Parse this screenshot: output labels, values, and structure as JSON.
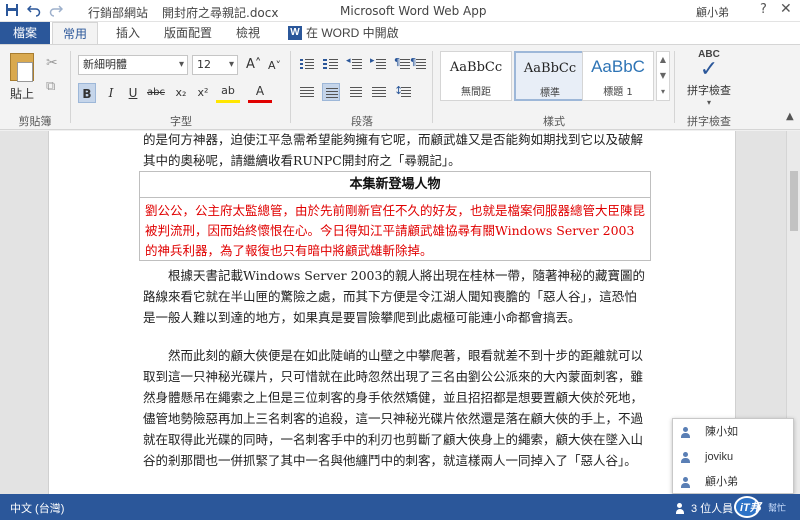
{
  "titlebar": {
    "site": "行銷部網站",
    "separator": "›",
    "doc_name": "開封府之尋親記.docx",
    "app_name": "Microsoft Word Web App",
    "user": "顧小弟",
    "help": "?",
    "close": "✕"
  },
  "tabs": {
    "file": "檔案",
    "home": "常用",
    "insert": "插入",
    "layout": "版面配置",
    "review": "檢視",
    "open_in_word": "在 WORD 中開啟",
    "word_icon": "W"
  },
  "ribbon": {
    "clipboard": {
      "paste": "貼上",
      "label": "剪貼簿"
    },
    "font": {
      "name": "新細明體",
      "size": "12",
      "grow": "A˄",
      "shrink": "A˅",
      "bold": "B",
      "italic": "I",
      "underline": "U",
      "strike": "abc",
      "subscript": "x₂",
      "superscript": "x²",
      "highlight": "ab",
      "font_color": "A",
      "label": "字型"
    },
    "paragraph": {
      "label": "段落"
    },
    "styles": {
      "items": [
        {
          "sample": "AaBbCc",
          "name": "無間距"
        },
        {
          "sample": "AaBbCc",
          "name": "標準"
        },
        {
          "sample": "AaBbC",
          "name": "標題 1"
        }
      ],
      "up": "▲",
      "down": "▼",
      "more": "▾",
      "label": "樣式"
    },
    "proofing": {
      "abc": "ABC",
      "check": "✓",
      "spell": "拼字檢查",
      "arrow": "▾",
      "label": "拼字檢查"
    },
    "collapse": "▲"
  },
  "document": {
    "intro": "的是何方神器，迫使江平急需希望能夠擁有它呢，而顧武雄又是否能夠如期找到它以及破解其中的奧秘呢，請繼續收看RUNPC開封府之「尋親記」。",
    "infobox": {
      "title": "本集新登場人物",
      "body": "劉公公，公主府太監總管，由於先前剛新官任不久的好友，也就是檔案伺服器總管大臣陳昆被判流刑，因而始終懷恨在心。今日得知江平請顧武雄協尋有關Windows Server 2003的神兵利器，為了報復也只有暗中將顧武雄斬除掉。"
    },
    "para1": "根據天書記載Windows Server 2003的親人將出現在桂林一帶，隨著神秘的藏寶圖的路線來看它就在半山匣的驚險之處，而其下方便是令江湖人聞知喪膽的「惡人谷」，這恐怕是一般人難以到達的地方，如果真是要冒險攀爬到此處極可能連小命都會搞丟。",
    "para2": "然而此刻的顧大俠便是在如此陡峭的山壁之中攀爬著，眼看就差不到十步的距離就可以取到這一只神秘光碟片，只可惜就在此時忽然出現了三名由劉公公派來的大內蒙面刺客，雖然身體懸吊在繩索之上但是三位刺客的身手依然矯健，並且招招都是想要置顧大俠於死地，儘管地勢險惡再加上三名刺客的追殺，這一只神秘光碟片依然還是落在顧大俠的手上，不過就在取得此光碟的同時，一名刺客手中的利刃也剪斷了顧大俠身上的繩索，顧大俠在墜入山谷的剎那間也一併抓緊了其中一名與他纏鬥中的刺客，就這樣兩人一同掉入了「惡人谷」。"
  },
  "presence": {
    "people": [
      "陳小如",
      "joviku",
      "顧小弟"
    ]
  },
  "statusbar": {
    "language": "中文 (台灣)",
    "editors": "3 位人員"
  },
  "watermark": {
    "logo": "iT邦",
    "sub": "幫忙"
  },
  "colors": {
    "accent": "#2b579a",
    "red_text": "#e00000"
  }
}
